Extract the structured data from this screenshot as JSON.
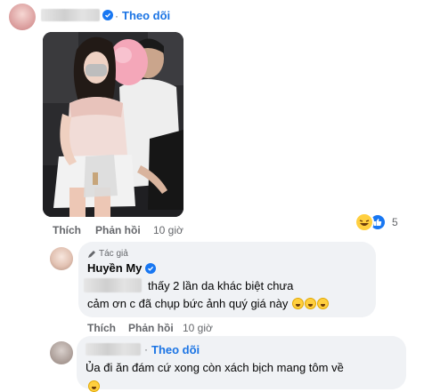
{
  "comment1": {
    "follow_label": "Theo dõi",
    "like_label": "Thích",
    "reply_label": "Phản hồi",
    "time": "10 giờ",
    "reaction_count": "5"
  },
  "reply": {
    "author_badge": "Tác giả",
    "author_name": "Huyền My",
    "line1_text": "thấy 2 lần da khác biệt chưa",
    "line2_text": "cảm ơn c đã chụp bức ảnh quý giá này",
    "like_label": "Thích",
    "reply_label": "Phản hồi",
    "time": "10 giờ"
  },
  "comment2": {
    "follow_label": "Theo dõi",
    "text": "Ủa đi ăn đám cứ xong còn xách bịch mang tôm về"
  },
  "colors": {
    "link_blue": "#1b74e4",
    "bubble_bg": "#f0f2f5",
    "secondary_text": "#65676b"
  }
}
